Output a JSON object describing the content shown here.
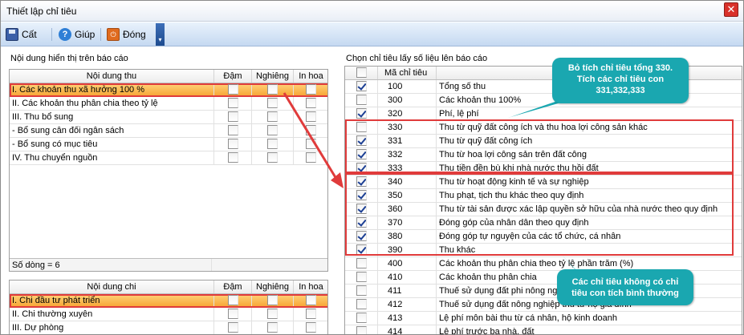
{
  "window": {
    "title": "Thiết lập chỉ tiêu",
    "close_glyph": "✕"
  },
  "toolbar": {
    "save_label": "Cất",
    "help_label": "Giúp",
    "close_label": "Đóng",
    "overflow_glyph": "▾"
  },
  "left": {
    "section_label": "Nội dung hiển thị trên báo cáo",
    "thu_grid": {
      "headers": {
        "name": "Nội dung thu",
        "bold": "Đậm",
        "italic": "Nghiêng",
        "upper": "In hoa"
      },
      "rows": [
        {
          "name": "I. Các khoản thu xã hưởng 100 %",
          "selected": true
        },
        {
          "name": "II. Các khoản thu phân chia theo tỷ lệ"
        },
        {
          "name": "III. Thu bổ sung"
        },
        {
          "name": "- Bổ sung cân đối ngân sách"
        },
        {
          "name": "- Bổ sung có mục tiêu"
        },
        {
          "name": "IV. Thu chuyển nguồn"
        }
      ],
      "footer": "Số dòng = 6"
    },
    "chi_grid": {
      "headers": {
        "name": "Nội dung chi",
        "bold": "Đậm",
        "italic": "Nghiêng",
        "upper": "In hoa"
      },
      "rows": [
        {
          "name": "I. Chi đầu tư phát triển",
          "selected": true
        },
        {
          "name": "II. Chi thường xuyên"
        },
        {
          "name": "III. Dự phòng"
        }
      ]
    }
  },
  "right": {
    "section_label": "Chọn chỉ tiêu lấy số liệu lên báo cáo",
    "headers": {
      "code": "Mã chỉ tiêu"
    },
    "rows": [
      {
        "checked": true,
        "code": "100",
        "name": "Tổng số thu"
      },
      {
        "checked": false,
        "code": "300",
        "name": "Các khoản thu 100%"
      },
      {
        "checked": true,
        "code": "320",
        "name": "Phí, lệ phí"
      },
      {
        "checked": false,
        "code": "330",
        "name": "Thu từ quỹ đất công ích và thu hoa lợi công sản khác"
      },
      {
        "checked": true,
        "code": "331",
        "name": "Thu từ quỹ đất công ích"
      },
      {
        "checked": true,
        "code": "332",
        "name": "Thu từ hoa lợi công sản trên đất công"
      },
      {
        "checked": true,
        "code": "333",
        "name": "Thu tiền đền bù khi nhà nước thu hồi đất"
      },
      {
        "checked": true,
        "code": "340",
        "name": "Thu từ hoạt động kinh tế và sự nghiệp"
      },
      {
        "checked": true,
        "code": "350",
        "name": "Thu phạt, tịch thu khác theo quy định"
      },
      {
        "checked": true,
        "code": "360",
        "name": "Thu từ tài sản được xác lập quyền sở hữu của nhà nước theo quy định"
      },
      {
        "checked": true,
        "code": "370",
        "name": "Đóng góp của nhân dân theo quy định"
      },
      {
        "checked": true,
        "code": "380",
        "name": "Đóng góp tự nguyện của các tổ chức, cá nhân"
      },
      {
        "checked": true,
        "code": "390",
        "name": "Thu khác"
      },
      {
        "checked": false,
        "code": "400",
        "name": "Các khoản thu phân chia theo tỷ lệ phần trăm (%)"
      },
      {
        "checked": false,
        "code": "410",
        "name": "Các khoản thu phân chia"
      },
      {
        "checked": false,
        "code": "411",
        "name": "Thuế sử dụng đất phi nông nghiệp"
      },
      {
        "checked": false,
        "code": "412",
        "name": "Thuế sử dụng đất nông nghiệp thu từ hộ gia đình"
      },
      {
        "checked": false,
        "code": "413",
        "name": "Lệ phí môn bài thu từ cá nhân, hộ kinh doanh"
      },
      {
        "checked": false,
        "code": "414",
        "name": "Lệ phí trước bạ nhà, đất"
      }
    ]
  },
  "annotations": {
    "callout_top": "Bỏ tích chỉ tiêu tổng 330. Tích các chỉ tiêu con 331,332,333",
    "callout_bottom": "Các chỉ tiêu không có chỉ tiêu con tích bình thường"
  },
  "colors": {
    "selection": "#f7a535",
    "annotation_red": "#e03b3b",
    "callout": "#1aa7b0"
  }
}
